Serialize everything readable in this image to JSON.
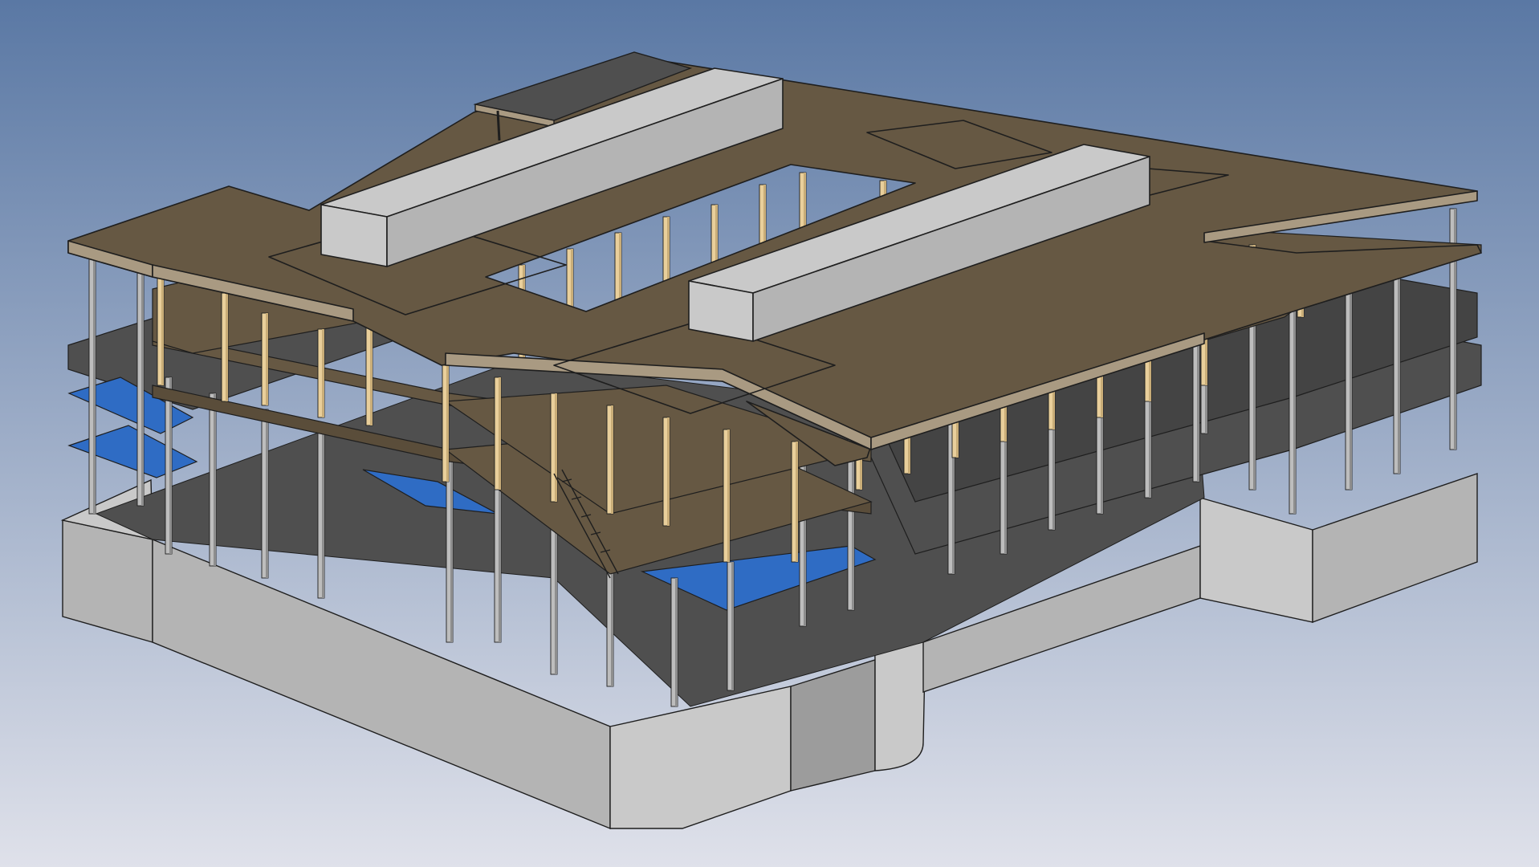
{
  "viewer": {
    "background": {
      "top_color": "#5a78a4",
      "bottom_color": "#dfe1ea"
    },
    "palette": {
      "slab_top": "#665843",
      "slab_top_dark": "#5a4d3a",
      "slab_edge": "#a99a82",
      "slab_gray": "#4f4f4f",
      "slab_gray_dark": "#444444",
      "wall_light": "#c9c9c9",
      "wall_mid": "#b4b4b4",
      "wall_dark": "#9c9c9c",
      "column_wood": "#e9cf9b",
      "column_wood_shade": "#c9ad78",
      "column_steel": "#bdbdbd",
      "column_steel_shade": "#8e8e8e",
      "balcony_blue": "#2f6cc4",
      "outline": "#1e1e1e"
    },
    "model": {
      "type": "building-structure-3d-isometric",
      "levels": 5,
      "elements": [
        "roof-slab",
        "upper-floor-slabs",
        "roof-penthouse-volumes",
        "courtyard-atrium",
        "timber-columns",
        "steel-columns",
        "blue-balcony-slabs",
        "stair",
        "basement-walls",
        "curved-wall"
      ]
    }
  }
}
